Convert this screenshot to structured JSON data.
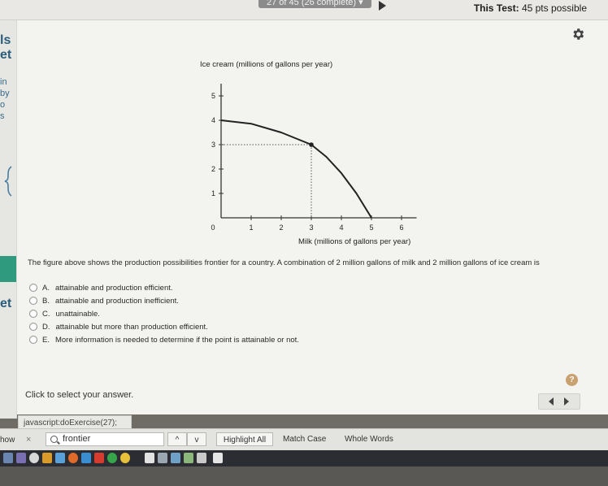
{
  "header": {
    "progress_text": "27 of 45 (26 complete)",
    "test_label": "This Test:",
    "test_points": "45 pts possible"
  },
  "left_strip": {
    "fragments": [
      "ls",
      "et",
      "in",
      "by",
      "o",
      "s",
      "et"
    ]
  },
  "chart_data": {
    "type": "line",
    "title": "",
    "ylabel": "Ice cream (millions of gallons per year)",
    "xlabel": "Milk (millions of gallons per year)",
    "xlim": [
      0,
      6.5
    ],
    "ylim": [
      0,
      5.5
    ],
    "x_ticks": [
      "0",
      "1",
      "2",
      "3",
      "4",
      "5",
      "6"
    ],
    "y_ticks": [
      "1",
      "2",
      "3",
      "4",
      "5"
    ],
    "series": [
      {
        "points": [
          [
            0,
            4
          ],
          [
            1,
            3.86
          ],
          [
            2,
            3.5
          ],
          [
            2.5,
            3.25
          ],
          [
            3,
            3
          ],
          [
            3.5,
            2.5
          ],
          [
            4,
            1.83
          ],
          [
            4.5,
            1.0
          ],
          [
            5,
            0
          ]
        ]
      }
    ],
    "highlighted_point": {
      "x": 3,
      "y": 3
    },
    "grid": false,
    "legend": "none"
  },
  "question": {
    "text": "The figure above shows the production possibilities frontier for a country. A combination of 2 million gallons of milk and 2 million gallons of ice cream is",
    "choices": [
      {
        "letter": "A.",
        "text": "attainable and production efficient."
      },
      {
        "letter": "B.",
        "text": "attainable and production inefficient."
      },
      {
        "letter": "C.",
        "text": "unattainable."
      },
      {
        "letter": "D.",
        "text": "attainable but more than production efficient."
      },
      {
        "letter": "E.",
        "text": "More information is needed to determine if the point is attainable or not."
      }
    ]
  },
  "footer": {
    "help_label": "?",
    "hint": "Click to select your answer.",
    "status_url": "javascript:doExercise(27);"
  },
  "findbar": {
    "left_label": "how",
    "close_label": "×",
    "query": "frontier",
    "prev_label": "^",
    "next_label": "v",
    "highlight_all": "Highlight All",
    "match_case": "Match Case",
    "whole_words": "Whole Words"
  },
  "colors": {
    "accent_green": "#2f9a7e",
    "help_tan": "#c9a070",
    "taskbar": "#2b2d33"
  }
}
